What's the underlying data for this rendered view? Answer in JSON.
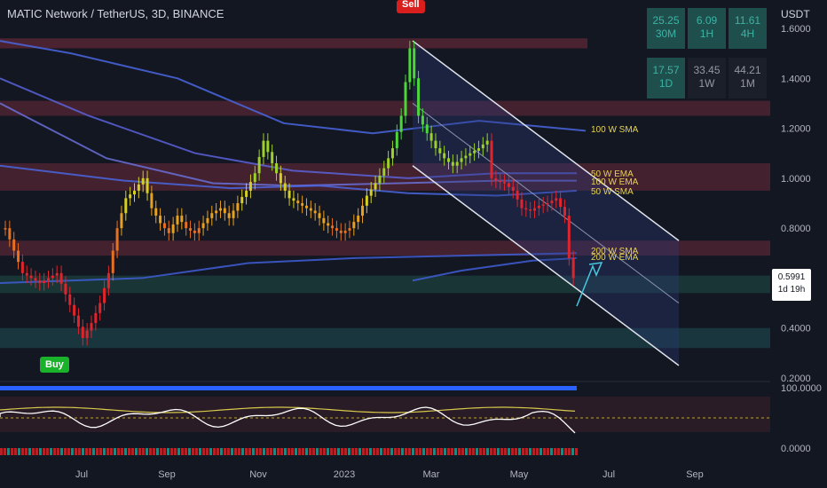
{
  "header": {
    "title": "MATIC Network / TetherUS, 3D, BINANCE"
  },
  "axis": {
    "unit": "USDT"
  },
  "price_tag": {
    "price": "0.5991",
    "countdown": "1d 19h"
  },
  "signals": {
    "buy": "Buy",
    "sell": "Sell"
  },
  "rsi_table": [
    {
      "value": "25.25",
      "tf": "30M",
      "bg": "#1f4f4d",
      "fg": "#3bb3a5"
    },
    {
      "value": "6.09",
      "tf": "1H",
      "bg": "#1f4f4d",
      "fg": "#3bb3a5"
    },
    {
      "value": "11.61",
      "tf": "4H",
      "bg": "#1f4f4d",
      "fg": "#3bb3a5"
    },
    {
      "value": "17.57",
      "tf": "1D",
      "bg": "#1f4f4d",
      "fg": "#3bb3a5"
    },
    {
      "value": "33.45",
      "tf": "1W",
      "bg": "#1b1f2a",
      "fg": "#9598a1"
    },
    {
      "value": "44.21",
      "tf": "1M",
      "bg": "#1b1f2a",
      "fg": "#9598a1"
    }
  ],
  "chart_data": {
    "type": "candlestick",
    "x_ticks": [
      "Jul",
      "Sep",
      "Nov",
      "2023",
      "Mar",
      "May",
      "Jul",
      "Sep"
    ],
    "y_ticks": [
      "1.6000",
      "1.4000",
      "1.2000",
      "1.0000",
      "0.8000",
      "0.6000",
      "0.4000",
      "0.2000"
    ],
    "ylim": [
      0.2,
      1.6
    ],
    "oscillator_ticks": [
      "100.0000",
      "0.0000"
    ],
    "last_price": 0.5991,
    "close_path": [
      [
        0,
        0.8
      ],
      [
        4,
        0.62
      ],
      [
        8,
        0.58
      ],
      [
        12,
        0.62
      ],
      [
        16,
        0.45
      ],
      [
        18,
        0.36
      ],
      [
        20,
        0.42
      ],
      [
        22,
        0.5
      ],
      [
        24,
        0.62
      ],
      [
        26,
        0.8
      ],
      [
        28,
        0.92
      ],
      [
        30,
        0.95
      ],
      [
        32,
        1.0
      ],
      [
        34,
        0.88
      ],
      [
        36,
        0.82
      ],
      [
        38,
        0.78
      ],
      [
        40,
        0.85
      ],
      [
        42,
        0.8
      ],
      [
        44,
        0.78
      ],
      [
        46,
        0.82
      ],
      [
        48,
        0.86
      ],
      [
        50,
        0.88
      ],
      [
        52,
        0.84
      ],
      [
        54,
        0.9
      ],
      [
        56,
        0.95
      ],
      [
        58,
        1.02
      ],
      [
        60,
        1.15
      ],
      [
        62,
        1.06
      ],
      [
        64,
        0.98
      ],
      [
        66,
        0.92
      ],
      [
        68,
        0.9
      ],
      [
        70,
        0.88
      ],
      [
        72,
        0.86
      ],
      [
        74,
        0.82
      ],
      [
        76,
        0.8
      ],
      [
        78,
        0.78
      ],
      [
        80,
        0.8
      ],
      [
        82,
        0.85
      ],
      [
        84,
        0.93
      ],
      [
        86,
        0.98
      ],
      [
        88,
        1.04
      ],
      [
        90,
        1.12
      ],
      [
        92,
        1.25
      ],
      [
        94,
        1.52
      ],
      [
        95,
        1.4
      ],
      [
        96,
        1.25
      ],
      [
        98,
        1.18
      ],
      [
        100,
        1.12
      ],
      [
        102,
        1.08
      ],
      [
        104,
        1.05
      ],
      [
        106,
        1.08
      ],
      [
        108,
        1.1
      ],
      [
        110,
        1.12
      ],
      [
        112,
        1.15
      ],
      [
        113,
        1.0
      ],
      [
        114,
        0.99
      ],
      [
        116,
        0.98
      ],
      [
        118,
        0.95
      ],
      [
        120,
        0.88
      ],
      [
        122,
        0.87
      ],
      [
        124,
        0.89
      ],
      [
        126,
        0.9
      ],
      [
        128,
        0.92
      ],
      [
        130,
        0.85
      ],
      [
        131,
        0.68
      ],
      [
        132,
        0.6
      ]
    ],
    "indicators": [
      {
        "name": "100 W SMA",
        "value": 1.19
      },
      {
        "name": "50 W EMA",
        "value": 1.02
      },
      {
        "name": "100 W EMA",
        "value": 0.99
      },
      {
        "name": "50 W SMA",
        "value": 0.96
      },
      {
        "name": "200 W SMA",
        "value": 0.7
      },
      {
        "name": "200 W EMA",
        "value": 0.68
      }
    ],
    "zones": [
      {
        "from": 1.52,
        "to": 1.56,
        "color": "#7a2e3d"
      },
      {
        "from": 1.25,
        "to": 1.31,
        "color": "#6b2a3a"
      },
      {
        "from": 0.95,
        "to": 1.06,
        "color": "#6b2a3a"
      },
      {
        "from": 0.69,
        "to": 0.75,
        "color": "#6b2a3a"
      },
      {
        "from": 0.54,
        "to": 0.61,
        "color": "#1f4f47"
      },
      {
        "from": 0.32,
        "to": 0.4,
        "color": "#1f4f53"
      }
    ]
  }
}
